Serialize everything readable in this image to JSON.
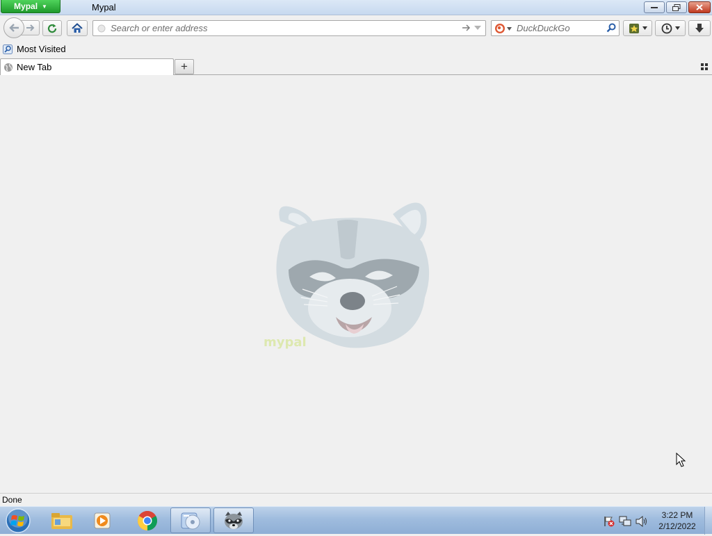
{
  "window": {
    "app_menu_label": "Mypal",
    "title": "Mypal",
    "controls": [
      "minimize-icon",
      "restore-icon",
      "close-icon"
    ]
  },
  "navbar": {
    "url_placeholder": "Search or enter address",
    "search_placeholder": "DuckDuckGo",
    "search_engine_icon": "duckduckgo-icon"
  },
  "bookmarks": {
    "most_visited_label": "Most Visited"
  },
  "tabs": [
    {
      "label": "New Tab",
      "selected": true
    }
  ],
  "status": {
    "text": "Done"
  },
  "taskbar": {
    "items": [
      "start-orb",
      "file-explorer-icon",
      "media-player-icon",
      "chrome-icon",
      "media-center-icon",
      "mypal-raccoon-icon"
    ],
    "clock_time": "3:22 PM",
    "clock_date": "2/12/2022"
  },
  "colors": {
    "app_menu_green": "#2aab37",
    "content_bg": "#f0f0f0",
    "taskbar_blue": "#9fbcde"
  }
}
